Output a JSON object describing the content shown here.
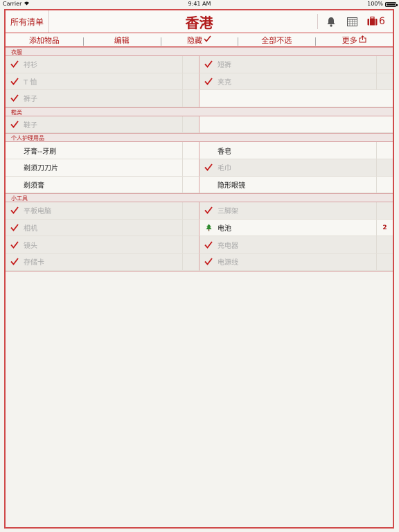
{
  "status": {
    "carrier": "Carrier",
    "time": "9:41 AM",
    "battery": "100%"
  },
  "header": {
    "all_lists": "所有清单",
    "title": "香港",
    "suitcase_count": "6"
  },
  "toolbar": {
    "add": "添加物品",
    "edit": "编辑",
    "hide": "隐藏",
    "deselect_all": "全部不选",
    "more": "更多"
  },
  "colors": {
    "accent": "#b01b1b",
    "border": "#d04a4a"
  },
  "sections": [
    {
      "name": "衣服",
      "items": [
        {
          "label": "衬衫",
          "checked": true
        },
        {
          "label": "短裤",
          "checked": true
        },
        {
          "label": "T 恤",
          "checked": true
        },
        {
          "label": "夹克",
          "checked": true
        },
        {
          "label": "裤子",
          "checked": true
        },
        {
          "label": "",
          "checked": false
        }
      ]
    },
    {
      "name": "鞋类",
      "items": [
        {
          "label": "鞋子",
          "checked": true
        },
        {
          "label": "",
          "checked": false
        }
      ]
    },
    {
      "name": "个人护理用品",
      "items": [
        {
          "label": "牙膏--牙刷",
          "checked": false
        },
        {
          "label": "香皂",
          "checked": false
        },
        {
          "label": "剃须刀刀片",
          "checked": false
        },
        {
          "label": "毛巾",
          "checked": true
        },
        {
          "label": "剃须膏",
          "checked": false
        },
        {
          "label": "隐形眼镜",
          "checked": false
        }
      ]
    },
    {
      "name": "小工具",
      "items": [
        {
          "label": "平板电脑",
          "checked": true
        },
        {
          "label": "三脚架",
          "checked": true
        },
        {
          "label": "相机",
          "checked": true
        },
        {
          "label": "电池",
          "checked": false,
          "icon": "tree-icon",
          "qty": "2"
        },
        {
          "label": "镜头",
          "checked": true
        },
        {
          "label": "充电器",
          "checked": true
        },
        {
          "label": "存储卡",
          "checked": true
        },
        {
          "label": "电源线",
          "checked": true
        }
      ]
    }
  ]
}
